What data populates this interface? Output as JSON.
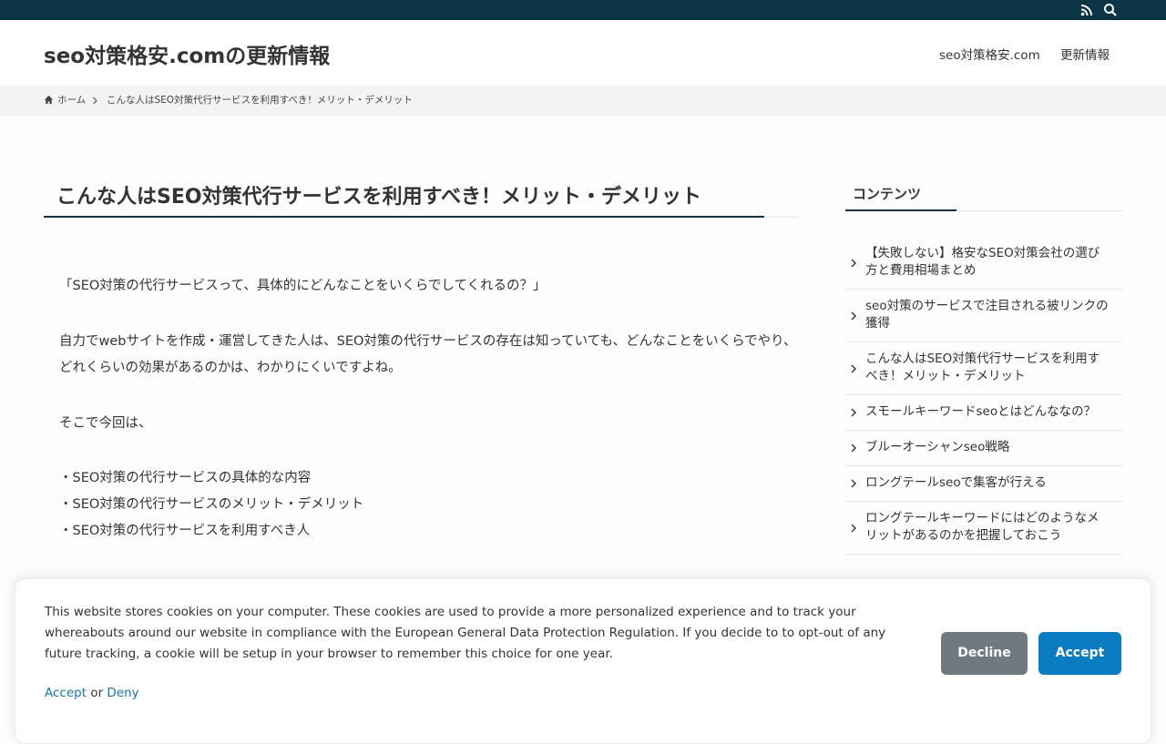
{
  "header": {
    "site_title": "seo対策格安.comの更新情報",
    "nav": [
      "seo対策格安.com",
      "更新情報"
    ]
  },
  "topbar": {
    "icons": [
      "rss-icon",
      "search-icon"
    ]
  },
  "breadcrumb": {
    "home": "ホーム",
    "current": "こんな人はSEO対策代行サービスを利用すべき！メリット・デメリット"
  },
  "article": {
    "title": "こんな人はSEO対策代行サービスを利用すべき！メリット・デメリット",
    "paragraphs": [
      "「SEO対策の代行サービスって、具体的にどんなことをいくらでしてくれるの？」",
      "自力でwebサイトを作成・運営してきた人は、SEO対策の代行サービスの存在は知っていても、どんなことをいくらでやり、どれくらいの効果があるのかは、わかりにくいですよね。",
      "そこで今回は、"
    ],
    "bullets": [
      "・SEO対策の代行サービスの具体的な内容",
      "・SEO対策の代行サービスのメリット・デメリット",
      "・SEO対策の代行サービスを利用すべき人"
    ]
  },
  "sidebar": {
    "heading": "コンテンツ",
    "items": [
      "【失敗しない】格安なSEO対策会社の選び方と費用相場まとめ",
      "seo対策のサービスで注目される被リンクの獲得",
      "こんな人はSEO対策代行サービスを利用すべき！メリット・デメリット",
      "スモールキーワードseoとはどんななの？",
      "ブルーオーシャンseo戦略",
      "ロングテールseoで集客が行える",
      "ロングテールキーワードにはどのようなメリットがあるのかを把握しておこう"
    ]
  },
  "cookie": {
    "message": "This website stores cookies on your computer. These cookies are used to provide a more personalized experience and to track your whereabouts around our website in compliance with the European General Data Protection Regulation. If you decide to to opt-out of any future tracking, a cookie will be setup in your browser to remember this choice for one year.",
    "accept_link": "Accept",
    "or": "or",
    "deny_link": "Deny",
    "decline_button": "Decline",
    "accept_button": "Accept"
  },
  "colors": {
    "topbar": "#0b3445",
    "accent": "#0b3445",
    "accept_button": "#0a7dc2",
    "decline_button": "#717980",
    "link": "#1a73b8"
  }
}
